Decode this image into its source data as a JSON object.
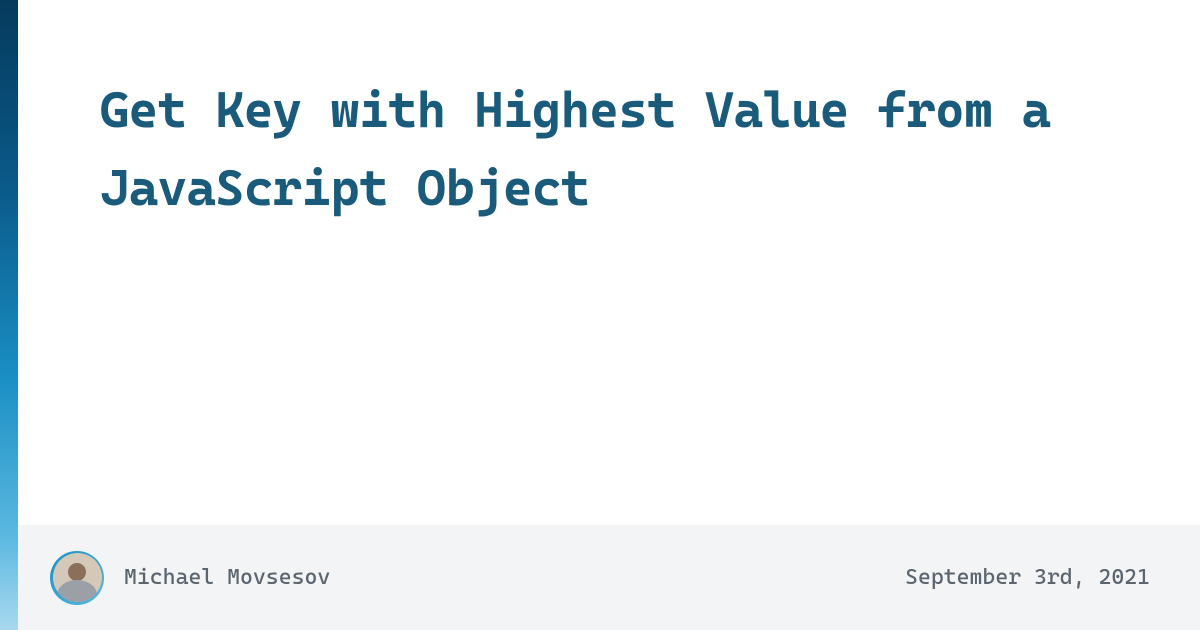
{
  "title": "Get Key with Highest Value from a JavaScript Object",
  "author": {
    "name": "Michael Movsesov"
  },
  "date": "September 3rd, 2021",
  "colors": {
    "accent_gradient_start": "#053a5c",
    "accent_gradient_end": "#a8d8ef",
    "title_color": "#1a5a7a",
    "footer_bg": "#f2f4f5",
    "meta_text": "#5a6570"
  }
}
